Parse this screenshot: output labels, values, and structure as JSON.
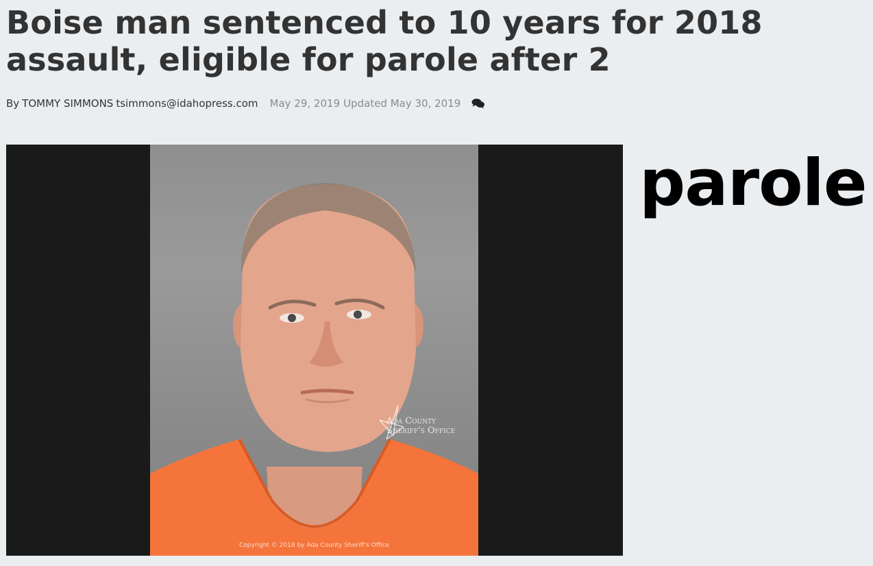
{
  "article": {
    "headline": "Boise man sentenced to 10 years for 2018 assault, eligible for parole after 2",
    "byline": {
      "by": "By",
      "author": "TOMMY SIMMONS",
      "email": "tsimmons@idahopress.com",
      "published": "May 29, 2019",
      "updated": "Updated May 30, 2019"
    },
    "photo": {
      "watermark_line1": "Ada County",
      "watermark_line2": "Sheriff's Office",
      "copyright": "Copyright © 2018 by Ada County Sheriff's Office"
    },
    "side_word": "parole"
  },
  "icons": {
    "comments": "comments-icon"
  },
  "colors": {
    "background": "#ebeef1",
    "headline": "#333333",
    "date": "#8a8a8a",
    "jumpsuit": "#f4743b"
  }
}
